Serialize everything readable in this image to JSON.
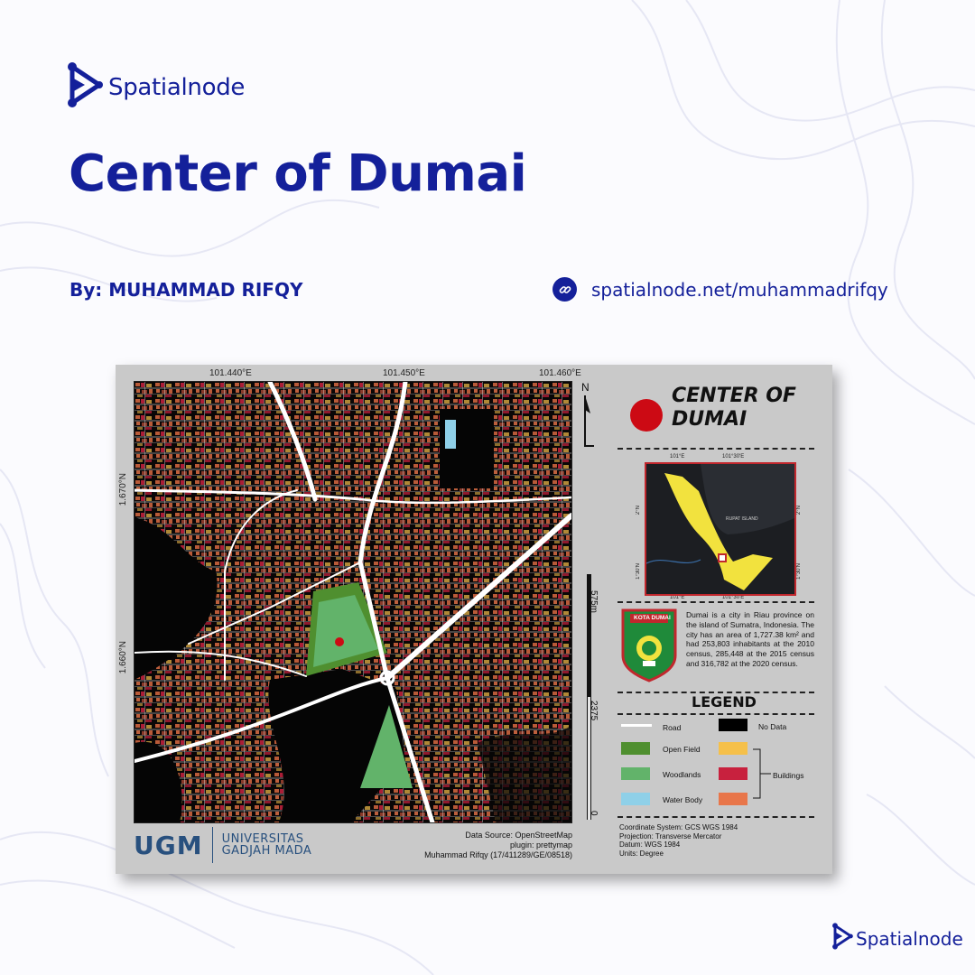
{
  "brand": {
    "name": "Spatialnode",
    "logo_icon": "play-node-icon"
  },
  "title": "Center of Dumai",
  "author": "By: MUHAMMAD RIFQY",
  "link": {
    "text": "spatialnode.net/muhammadrifqy",
    "icon": "link-icon"
  },
  "map": {
    "longitude_labels": [
      "101.440°E",
      "101.450°E",
      "101.460°E"
    ],
    "latitude_labels": [
      "1.670°N",
      "1.660°N"
    ],
    "north_label": "N",
    "scale_labels": [
      "575m",
      "2375",
      "0"
    ],
    "data_source": "Data Source: OpenStreetMap",
    "plugin": "plugin: prettymap",
    "author_line": "Muhammad Rifqy (17/411289/GE/08518)",
    "university_short": "UGM",
    "university_line1": "UNIVERSITAS",
    "university_line2": "GADJAH MADA",
    "side_title_line1": "CENTER OF",
    "side_title_line2": "DUMAI",
    "inset": {
      "top_ticks": [
        "101°E",
        "101°30'E"
      ],
      "bottom_ticks": [
        "101°E",
        "101°30'E"
      ],
      "left_ticks": [
        "2°N",
        "1°30'N"
      ],
      "right_ticks": [
        "2°N",
        "1°30'N"
      ],
      "island_label": "RUPAT ISLAND"
    },
    "crest_label": "KOTA DUMAI",
    "description": "Dumai is a city in Riau province on the island of Sumatra, Indonesia. The city has an area of 1,727.38 km² and had 253,803 inhabitants at the 2010 census, 285,448 at the 2015 census and 316,782 at the 2020 census.",
    "legend": {
      "title": "LEGEND",
      "items": [
        {
          "label": "Road",
          "color": "#ffffff"
        },
        {
          "label": "No Data",
          "color": "#000000"
        },
        {
          "label": "Open Field",
          "color": "#4f8f2f"
        },
        {
          "label": "Woodlands",
          "color": "#62b36a"
        },
        {
          "label": "Water Body",
          "color": "#8fd0e8"
        },
        {
          "label": "Buildings",
          "colors": [
            "#f5c04a",
            "#c8213e",
            "#e8764a"
          ]
        }
      ]
    },
    "footer": {
      "coordinate_system": "Coordinate System: GCS WGS 1984",
      "projection": "Projection: Transverse Mercator",
      "datum": "Datum: WGS 1984",
      "units": "Units: Degree"
    }
  },
  "colors": {
    "brand": "#14209a",
    "card_bg": "#c9c9c9",
    "accent_red": "#cc0a14"
  }
}
